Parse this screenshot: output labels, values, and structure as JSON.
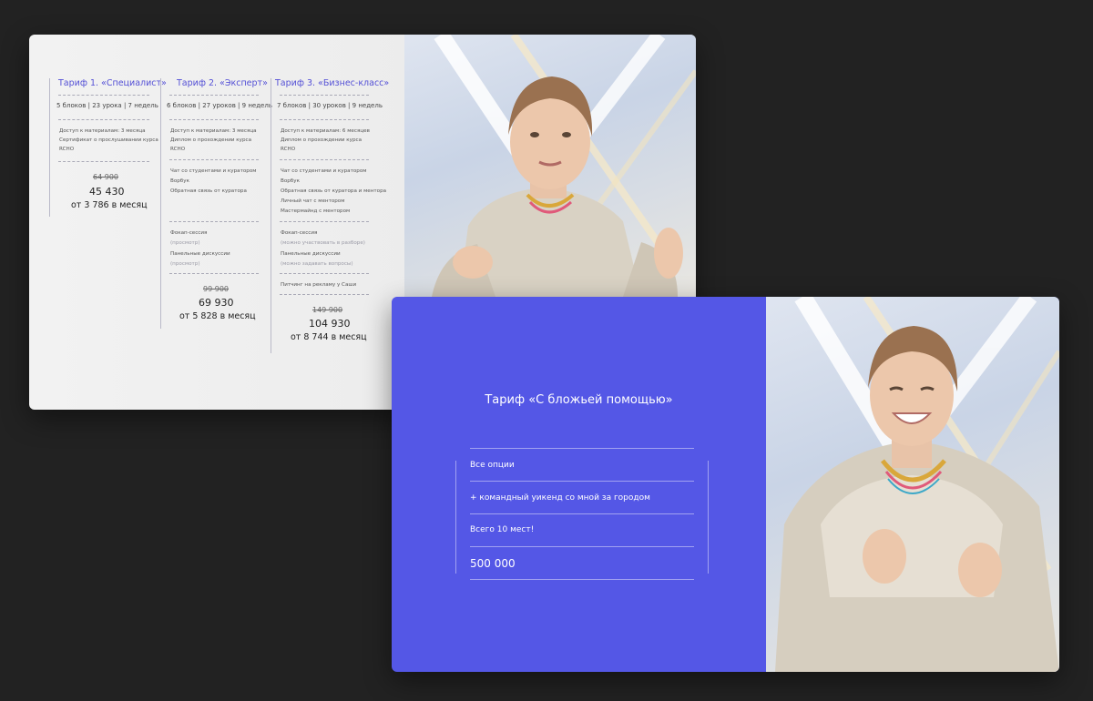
{
  "slide1": {
    "tariffs": [
      {
        "title": "Тариф 1. «Специалист»",
        "meta": "5 блоков | 23 урока | 7 недель",
        "group1": [
          "Доступ к материалам: 3 месяца",
          "Сертификат о прослушивании курса",
          "RCHO"
        ],
        "group2": [],
        "group3": [],
        "old_price": "64 900",
        "price": "45 430",
        "monthly": "от 3 786 в месяц"
      },
      {
        "title": "Тариф 2. «Эксперт»",
        "meta": "6 блоков | 27 уроков | 9 недель",
        "group1": [
          "Доступ к материалам: 3 месяца",
          "Диплом о прохождении курса",
          "RCHO"
        ],
        "group2": [
          "Чат со студентами и куратором",
          "Ворбук",
          "Обратная связь от куратора"
        ],
        "group3": [
          "Фокап-сессия",
          "(просмотр)",
          "Панельные дискуссии",
          "(просмотр)"
        ],
        "old_price": "99 900",
        "price": "69 930",
        "monthly": "от 5 828 в месяц"
      },
      {
        "title": "Тариф 3. «Бизнес-класс»",
        "meta": "7 блоков | 30 уроков | 9 недель",
        "group1": [
          "Доступ к материалам: 6 месяцев",
          "Диплом о прохождении курса",
          "RCHO"
        ],
        "group2": [
          "Чат со студентами и куратором",
          "Ворбук",
          "Обратная связь от куратора и ментора",
          "Личный чат с ментором",
          "Мастермайнд с ментором"
        ],
        "group3": [
          "Фокап-сессия",
          "(можно участвовать в разборе)",
          "Панельные дискуссии",
          "(можно задавать вопросы)"
        ],
        "group4": [
          "Питчинг на рекламу у Саши"
        ],
        "old_price": "149 900",
        "price": "104 930",
        "monthly": "от 8 744 в месяц"
      }
    ]
  },
  "slide2": {
    "title": "Тариф «С бложьей помощью»",
    "options": [
      "Все опции",
      "+ командный уикенд со мной за городом",
      "Всего 10 мест!"
    ],
    "price": "500 000"
  },
  "colors": {
    "accent": "#5450d6",
    "slide2_bg": "#5457e6",
    "page_bg": "#222222"
  }
}
